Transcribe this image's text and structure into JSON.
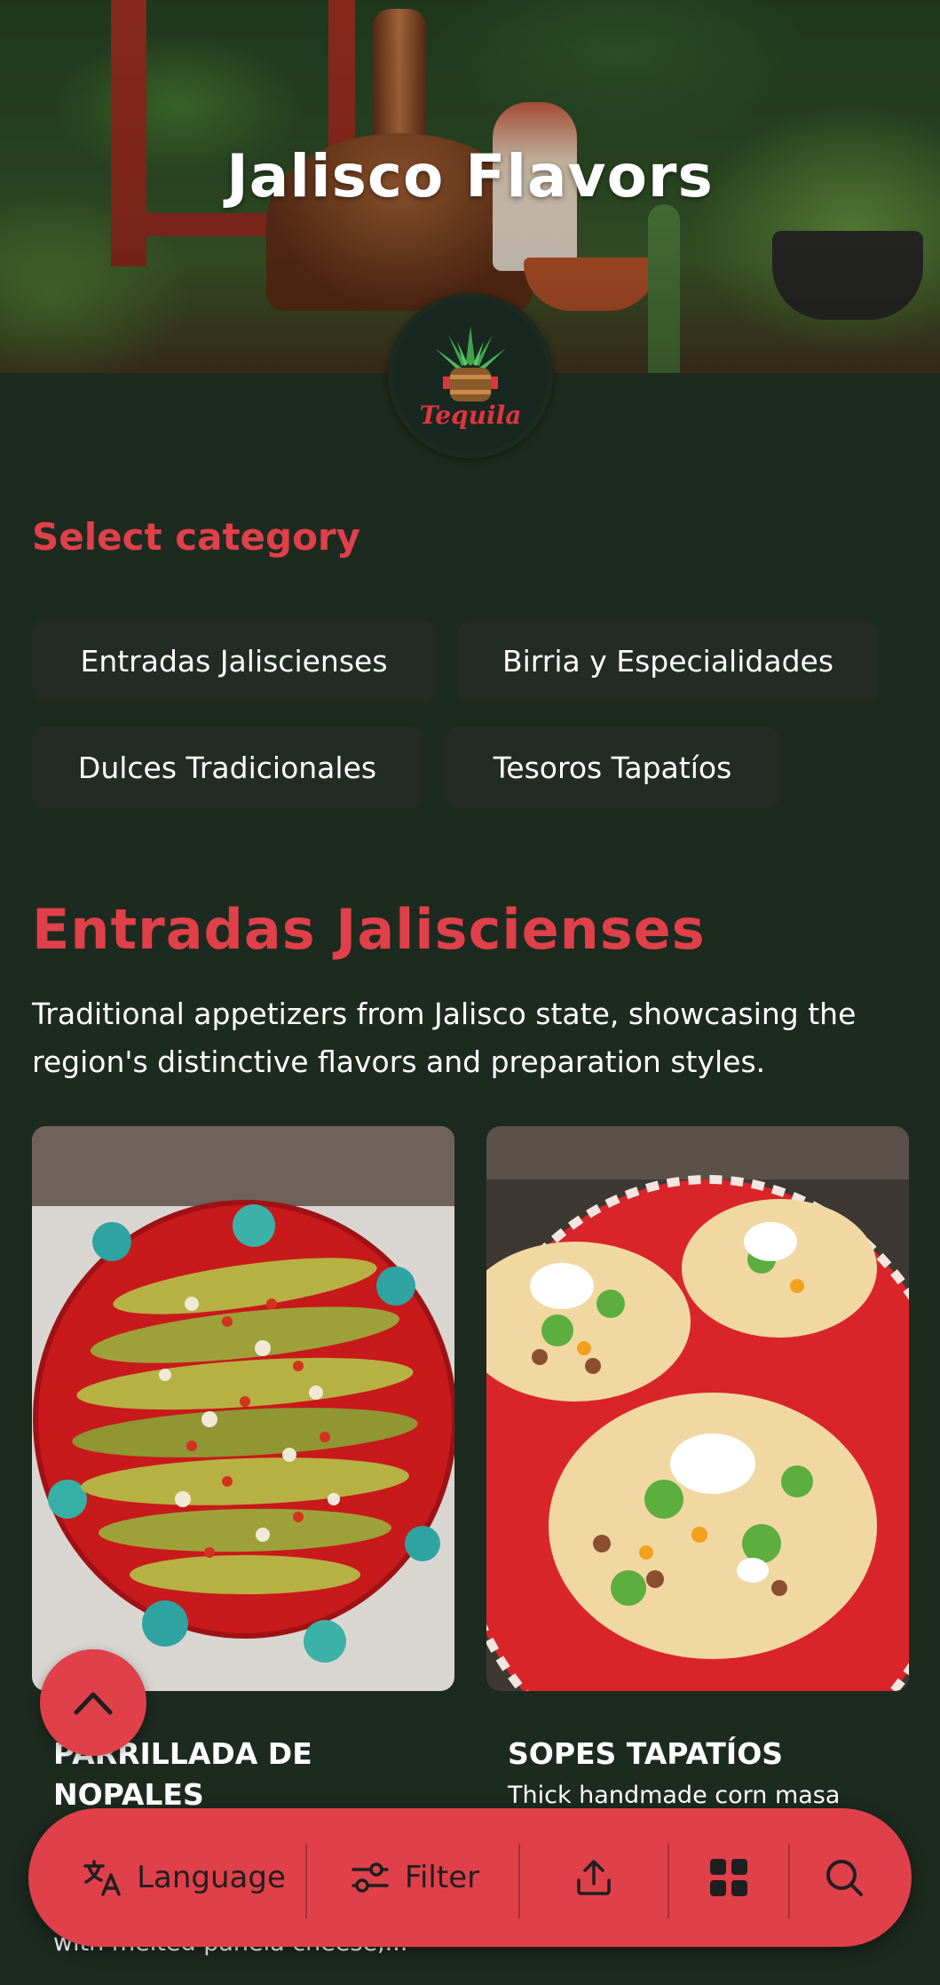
{
  "hero": {
    "title": "Jalisco Flavors"
  },
  "logo": {
    "text": "Tequila"
  },
  "categories": {
    "heading": "Select category",
    "items": [
      {
        "label": "Entradas Jaliscienses"
      },
      {
        "label": "Birria y Especialidades"
      },
      {
        "label": "Dulces Tradicionales"
      },
      {
        "label": "Tesoros Tapatíos"
      }
    ]
  },
  "section": {
    "title": "Entradas Jaliscienses",
    "description": "Traditional appetizers from Jalisco state, showcasing the region's distinctive flavors and preparation styles."
  },
  "cards": [
    {
      "title": "PARRILLADA DE NOPALES",
      "description": "with melted panela cheese,..."
    },
    {
      "title": "SOPES TAPATÍOS",
      "description": "Thick handmade corn masa"
    }
  ],
  "bottom_bar": {
    "language_label": "Language",
    "filter_label": "Filter",
    "share_icon": "share-icon",
    "grid_icon": "grid-icon",
    "search_icon": "search-icon"
  },
  "colors": {
    "background": "#1d2a20",
    "accent": "#e0404a",
    "chip": "#232b24"
  }
}
